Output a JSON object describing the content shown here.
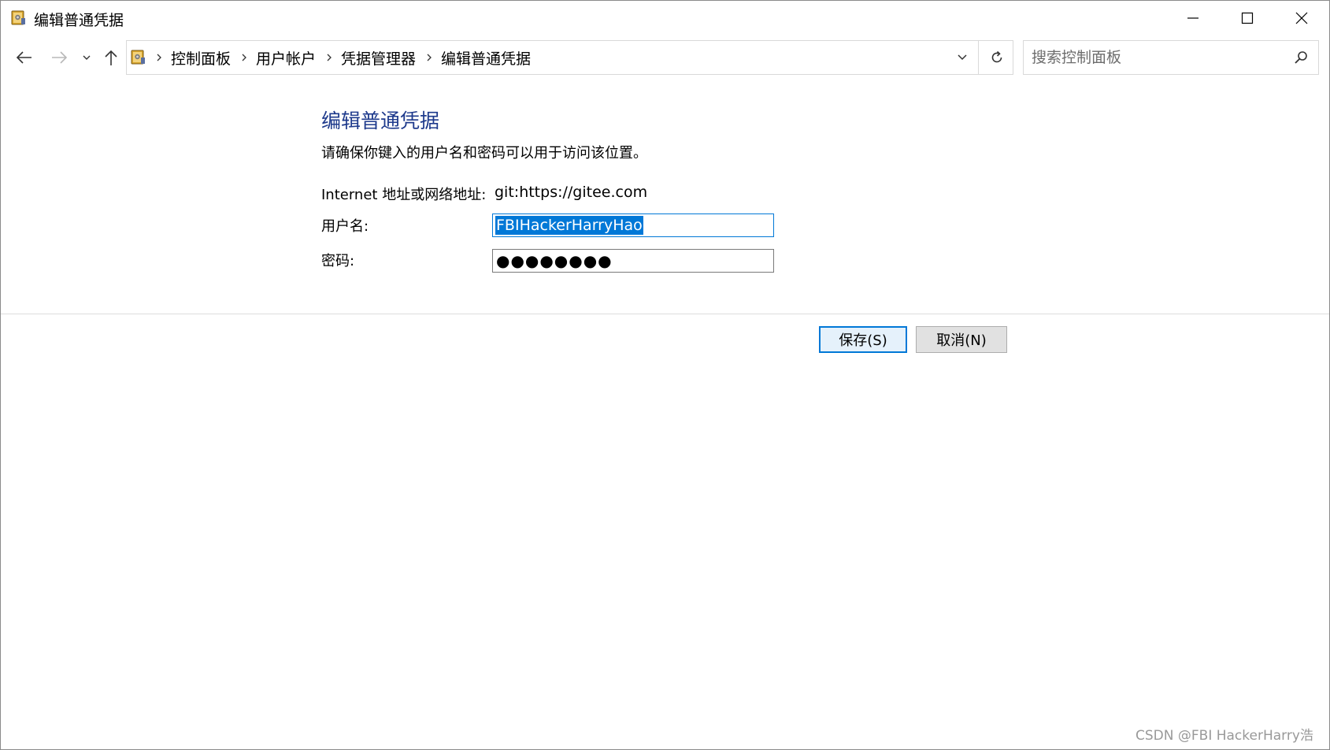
{
  "window": {
    "title": "编辑普通凭据"
  },
  "icons": {
    "app": "credential-manager-icon",
    "minimize": "minimize-icon",
    "maximize": "maximize-icon",
    "close": "close-icon",
    "back": "arrow-left-icon",
    "forward": "arrow-right-icon",
    "recent": "chevron-down-icon",
    "up": "arrow-up-icon",
    "refresh": "refresh-icon",
    "search": "search-icon"
  },
  "nav": {
    "breadcrumbs": [
      "控制面板",
      "用户帐户",
      "凭据管理器",
      "编辑普通凭据"
    ],
    "search_placeholder": "搜索控制面板"
  },
  "content": {
    "title": "编辑普通凭据",
    "description": "请确保你键入的用户名和密码可以用于访问该位置。",
    "address_label": "Internet 地址或网络地址:",
    "address_value": "git:https://gitee.com",
    "username_label": "用户名:",
    "username_value": "FBIHackerHarryHao",
    "password_label": "密码:",
    "password_mask": "●●●●●●●●"
  },
  "buttons": {
    "save": "保存(S)",
    "cancel": "取消(N)"
  },
  "watermark": "CSDN @FBI HackerHarry浩",
  "colors": {
    "accent": "#0078d7",
    "title_blue": "#1e3a8c"
  }
}
